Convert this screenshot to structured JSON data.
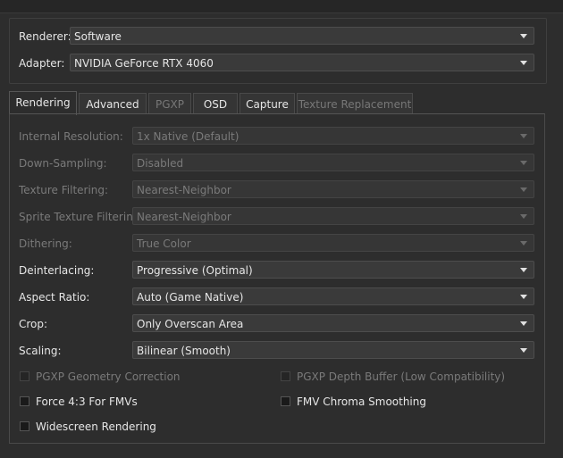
{
  "device": {
    "renderer_label": "Renderer:",
    "renderer_value": "Software",
    "adapter_label": "Adapter:",
    "adapter_value": "NVIDIA GeForce RTX 4060"
  },
  "tabs": [
    {
      "label": "Rendering",
      "state": "active"
    },
    {
      "label": "Advanced",
      "state": "enabled"
    },
    {
      "label": "PGXP",
      "state": "disabled"
    },
    {
      "label": "OSD",
      "state": "enabled"
    },
    {
      "label": "Capture",
      "state": "enabled"
    },
    {
      "label": "Texture Replacement",
      "state": "disabled"
    }
  ],
  "rendering": {
    "internal_resolution": {
      "label": "Internal Resolution:",
      "value": "1x Native (Default)",
      "enabled": false
    },
    "down_sampling": {
      "label": "Down-Sampling:",
      "value": "Disabled",
      "enabled": false
    },
    "texture_filtering": {
      "label": "Texture Filtering:",
      "value": "Nearest-Neighbor",
      "enabled": false
    },
    "sprite_texture_filtering": {
      "label": "Sprite Texture Filtering:",
      "value": "Nearest-Neighbor",
      "enabled": false
    },
    "dithering": {
      "label": "Dithering:",
      "value": "True Color",
      "enabled": false
    },
    "deinterlacing": {
      "label": "Deinterlacing:",
      "value": "Progressive (Optimal)",
      "enabled": true
    },
    "aspect_ratio": {
      "label": "Aspect Ratio:",
      "value": "Auto (Game Native)",
      "enabled": true
    },
    "crop": {
      "label": "Crop:",
      "value": "Only Overscan Area",
      "enabled": true
    },
    "scaling": {
      "label": "Scaling:",
      "value": "Bilinear (Smooth)",
      "enabled": true
    }
  },
  "checkboxes": {
    "pgxp_geometry": {
      "label": "PGXP Geometry Correction",
      "checked": false,
      "enabled": false
    },
    "pgxp_depth": {
      "label": "PGXP Depth Buffer (Low Compatibility)",
      "checked": false,
      "enabled": false
    },
    "force_43": {
      "label": "Force 4:3 For FMVs",
      "checked": false,
      "enabled": true
    },
    "fmv_chroma": {
      "label": "FMV Chroma Smoothing",
      "checked": false,
      "enabled": true
    },
    "widescreen": {
      "label": "Widescreen Rendering",
      "checked": false,
      "enabled": true
    }
  }
}
